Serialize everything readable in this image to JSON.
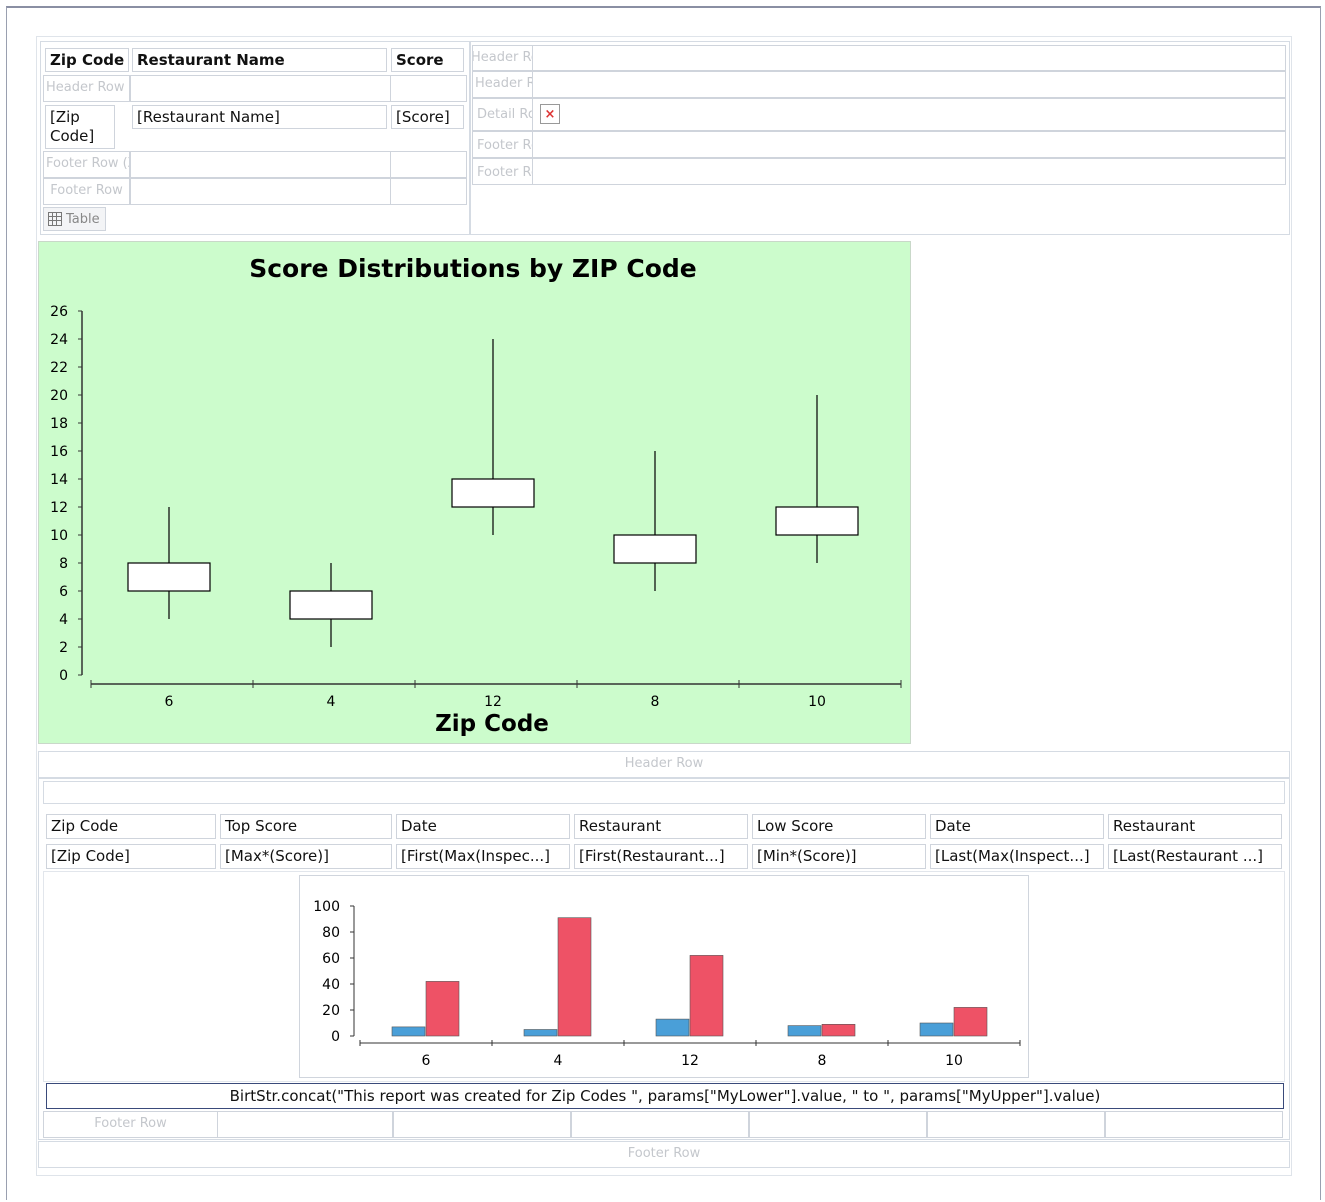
{
  "table1": {
    "headers": [
      "Zip Code",
      "Restaurant Name",
      "Score"
    ],
    "detail": [
      "[Zip Code]",
      "[Restaurant Name]",
      "[Score]"
    ],
    "ghost_header_row": "Header Row (Zi",
    "ghost_footer_row_zip": "Footer Row (Zi",
    "ghost_footer_row": "Footer Row",
    "table_label": "Table"
  },
  "table2": {
    "ghost_rows": [
      "Header Ro",
      "Header Row",
      "Detail Row",
      "Footer Row (",
      "Footer Ro"
    ],
    "broken_image": "×"
  },
  "chart1": {
    "title": "Score Distributions by ZIP Code",
    "xlabel": "Zip Code"
  },
  "outer": {
    "header_row": "Header Row",
    "footer_row": "Footer Row",
    "inner_footer_row": "Footer Row"
  },
  "summary_table": {
    "headers": [
      "Zip Code",
      "Top Score",
      "Date",
      "Restaurant",
      "Low Score",
      "Date",
      "Restaurant"
    ],
    "detail": [
      "[Zip Code]",
      "[Max*(Score)]",
      "[First(Max(Inspec...]",
      "[First(Restaurant...]",
      "[Min*(Score)]",
      "[Last(Max(Inspect...]",
      "[Last(Restaurant ...]"
    ]
  },
  "concat_text": "BirtStr.concat(\"This report was created for Zip Codes \", params[\"MyLower\"].value, \" to \", params[\"MyUpper\"].value)",
  "colors": {
    "chart_bg": "#ccfccc",
    "bar_blue": "#4a9fd8",
    "bar_red": "#ee5266"
  },
  "chart_data": [
    {
      "type": "boxplot",
      "title": "Score Distributions by ZIP Code",
      "xlabel": "Zip Code",
      "ylabel": "",
      "categories": [
        "6",
        "4",
        "12",
        "8",
        "10"
      ],
      "ylim": [
        0,
        26
      ],
      "yticks": [
        0,
        2,
        4,
        6,
        8,
        10,
        12,
        14,
        16,
        18,
        20,
        22,
        24,
        26
      ],
      "boxes": [
        {
          "min": 4,
          "q1": 6,
          "q3": 8,
          "max": 12
        },
        {
          "min": 2,
          "q1": 4,
          "q3": 6,
          "max": 8
        },
        {
          "min": 10,
          "q1": 12,
          "q3": 14,
          "max": 24
        },
        {
          "min": 6,
          "q1": 8,
          "q3": 10,
          "max": 16
        },
        {
          "min": 8,
          "q1": 10,
          "q3": 12,
          "max": 20
        }
      ],
      "grid": false,
      "legend": "none"
    },
    {
      "type": "bar",
      "title": "",
      "xlabel": "",
      "ylabel": "",
      "categories": [
        "6",
        "4",
        "12",
        "8",
        "10"
      ],
      "ylim": [
        0,
        100
      ],
      "yticks": [
        0,
        20,
        40,
        60,
        80,
        100
      ],
      "series": [
        {
          "values": [
            7,
            5,
            13,
            8,
            10
          ],
          "color": "#4a9fd8"
        },
        {
          "values": [
            42,
            91,
            62,
            9,
            22
          ],
          "color": "#ee5266"
        }
      ],
      "grid": false,
      "legend": "none"
    }
  ]
}
